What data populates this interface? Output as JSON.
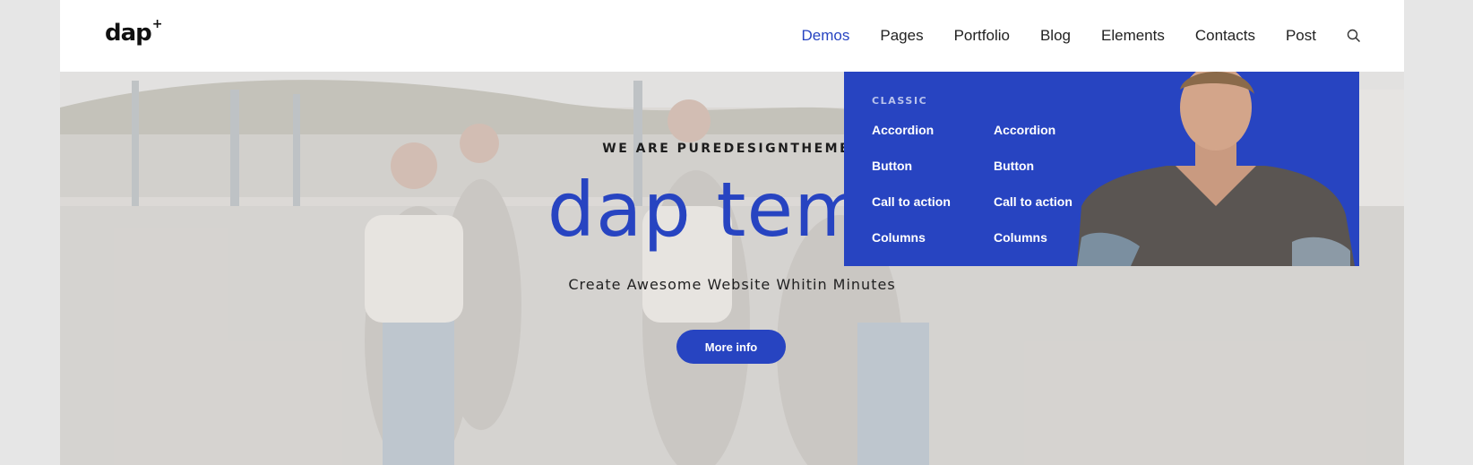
{
  "header": {
    "logo": "dap",
    "logo_mark": "+",
    "nav": [
      {
        "label": "Demos",
        "active": true
      },
      {
        "label": "Pages",
        "active": false
      },
      {
        "label": "Portfolio",
        "active": false
      },
      {
        "label": "Blog",
        "active": false
      },
      {
        "label": "Elements",
        "active": false
      },
      {
        "label": "Contacts",
        "active": false
      },
      {
        "label": "Post",
        "active": false
      }
    ],
    "search_icon": "search-icon"
  },
  "hero": {
    "tagline": "WE ARE PUREDESIGNTHEMES",
    "headline": "dap temp",
    "subtitle": "Create Awesome Website Whitin Minutes",
    "button_label": "More info"
  },
  "mega_menu": {
    "section_title": "CLASSIC",
    "column1": [
      "Accordion",
      "Button",
      "Call to action",
      "Columns"
    ],
    "column2": [
      "Accordion",
      "Button",
      "Call to action",
      "Columns"
    ]
  },
  "colors": {
    "accent": "#2744c1",
    "page_bg": "#e6e6e6",
    "header_bg": "#ffffff",
    "text_dark": "#222222"
  }
}
